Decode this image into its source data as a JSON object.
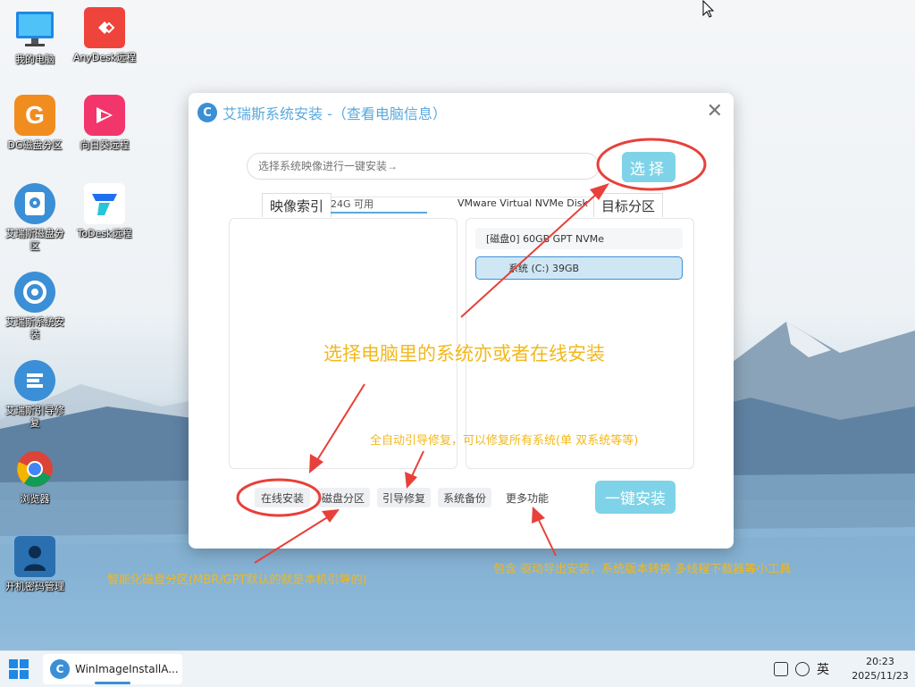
{
  "desktop": {
    "icons": [
      {
        "label": "我的电脑",
        "icon": "monitor-icon"
      },
      {
        "label": "AnyDesk远程",
        "icon": "anydesk-icon"
      },
      {
        "label": "DG磁盘分区",
        "icon": "diskgenius-icon"
      },
      {
        "label": "向日葵远程",
        "icon": "sunlogin-icon"
      },
      {
        "label": "艾瑞斯磁盘分区",
        "icon": "disk-partition-icon"
      },
      {
        "label": "ToDesk远程",
        "icon": "todesk-icon"
      },
      {
        "label": "艾瑞斯系统安装",
        "icon": "system-install-icon"
      },
      {
        "label": "艾瑞斯引导修复",
        "icon": "boot-repair-icon"
      },
      {
        "label": "浏览器",
        "icon": "chrome-icon"
      },
      {
        "label": "开机密码管理",
        "icon": "password-manager-icon"
      }
    ]
  },
  "window": {
    "title": "艾瑞斯系统安装 -（查看电脑信息）",
    "close_symbol": "✕",
    "path_placeholder": "选择系统映像进行一键安装→",
    "select_button": "选择",
    "tab_image_index": "映像索引",
    "tab_target_partition": "目标分区",
    "disk_free": "24G 可用",
    "disk_model": "VMware Virtual NVMe Disk",
    "disk_header": "[磁盘0]  60GB  GPT  NVMe",
    "partition_label": "系统 (C:) 39GB",
    "feature_buttons": [
      "在线安装",
      "磁盘分区",
      "引导修复",
      "系统备份"
    ],
    "more_button": "更多功能",
    "install_button": "一键安装"
  },
  "annotations": {
    "select_hint": "选择电脑里的系统亦或者在线安装",
    "boot_repair_hint": "全自动引导修复，可以修复所有系统(单 双系统等等)",
    "partition_hint": "智能化磁盘分区(MBR/GPT默认的就是本机引导的)",
    "more_hint": "包含 驱动导出安装，系统版本转换 多线程下载器等小工具"
  },
  "taskbar": {
    "app_label": "WinImageInstallA...",
    "ime_label": "英",
    "time": "20:23",
    "date": "2025/11/23"
  },
  "colors": {
    "accent": "#7fd3e8",
    "title_blue": "#5aa9de",
    "annotation_yellow": "#f2b81c",
    "arrow_red": "#e8403a"
  }
}
